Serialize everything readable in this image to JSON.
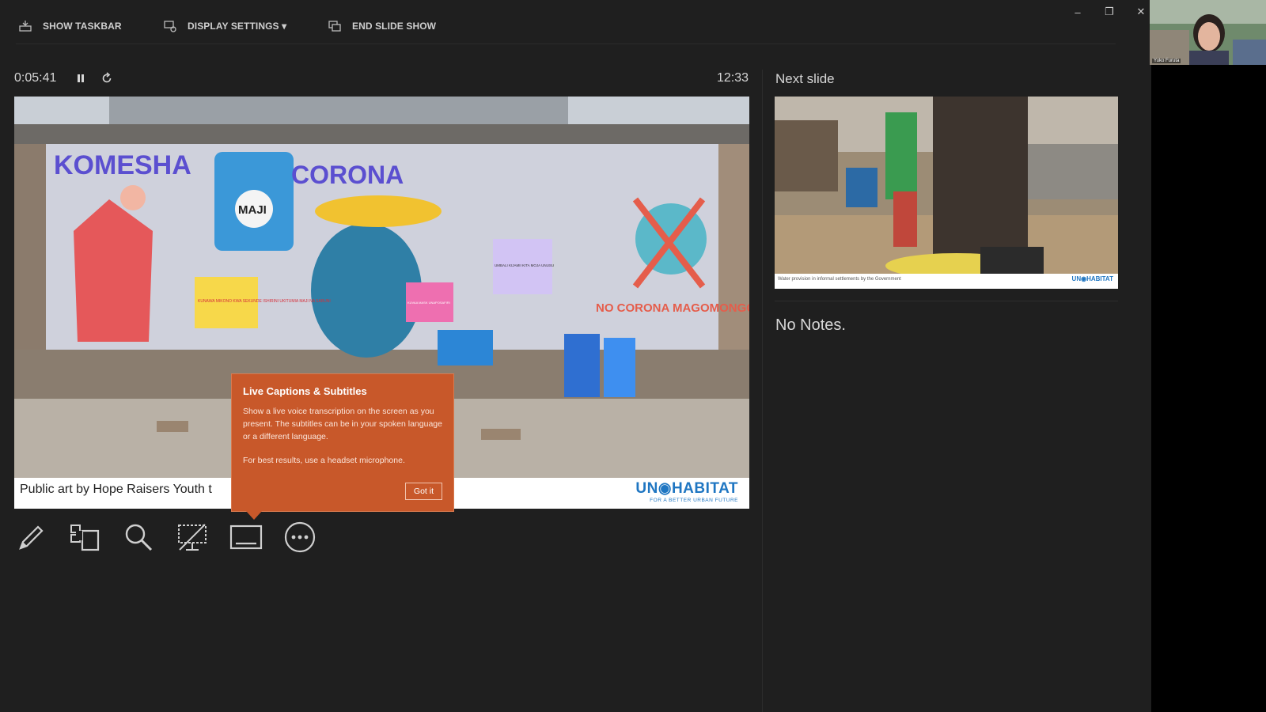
{
  "toolbar": {
    "show_taskbar": "SHOW TASKBAR",
    "display_settings": "DISPLAY SETTINGS ▾",
    "end_slide_show": "END SLIDE SHOW"
  },
  "window_controls": {
    "minimize": "–",
    "restore": "❐",
    "close": "✕"
  },
  "presenter": {
    "elapsed_time": "0:05:41",
    "clock": "12:33",
    "next_slide_label": "Next slide",
    "notes": "No Notes."
  },
  "current_slide": {
    "mural_texts": [
      "KOMESHA",
      "CORONA",
      "MAJI",
      "KUNAWA MIKONO KWA SEKUNDE ISHIRINI UKITUMIA MAJI NA SABUNI",
      "UMBALI KIJAMII KITA MOJA UNUSU",
      "KUVAA MASK UNAPOSAFIRI",
      "NO CORONA MAGOMONGO"
    ],
    "caption": "Public art by Hope Raisers Youth t",
    "logo": "UN◉HABITAT",
    "logo_tagline": "FOR A BETTER URBAN FUTURE"
  },
  "next_slide": {
    "caption": "Water provision in informal settlements by the Government",
    "logo": "UN◉HABITAT"
  },
  "popup": {
    "title": "Live Captions & Subtitles",
    "body": "Show a live voice transcription on the screen as you present. The subtitles can be in your spoken language or a different language.",
    "tip": "For best results, use a headset microphone.",
    "button": "Got it"
  },
  "webcam": {
    "name": "Yuko Furuta"
  },
  "icons": {
    "pause": "pause-icon",
    "restart": "restart-icon",
    "pen": "pen-icon",
    "slides": "see-all-slides-icon",
    "zoom": "zoom-icon",
    "black_screen": "black-screen-icon",
    "subtitles": "subtitles-icon",
    "more": "more-options-icon"
  },
  "colors": {
    "background": "#1f1f1f",
    "popup": "#c8582a",
    "un_blue": "#1f76c2"
  }
}
